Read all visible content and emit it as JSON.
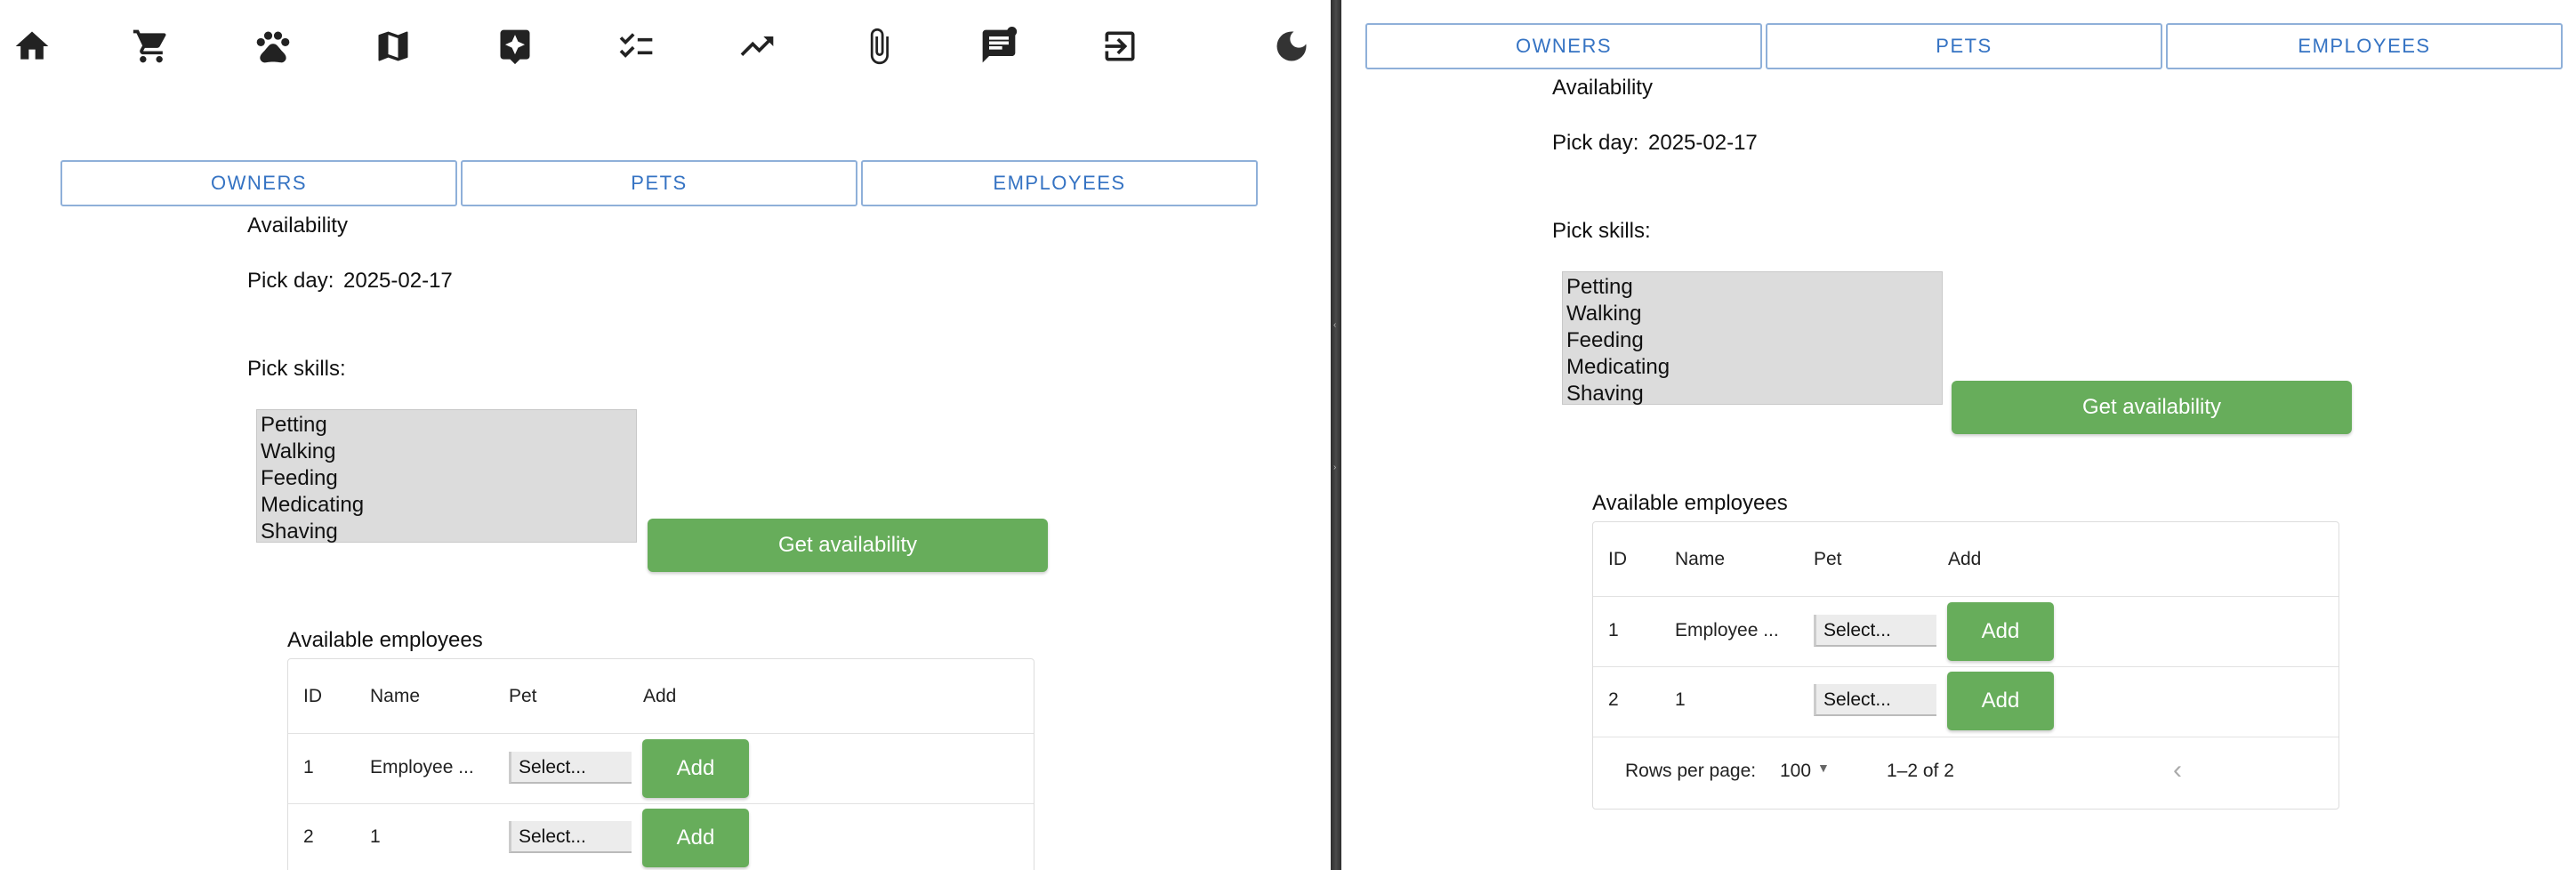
{
  "toolbar": {
    "icons": [
      "home-icon",
      "cart-icon",
      "paw-icon",
      "map-icon",
      "star-chat-icon",
      "checklist-icon",
      "trending-up-icon",
      "attachment-icon",
      "feedback-icon",
      "logout-icon",
      "dark-mode-icon"
    ]
  },
  "tabs": [
    "OWNERS",
    "PETS",
    "EMPLOYEES"
  ],
  "availability": {
    "heading": "Availability",
    "pick_day_label": "Pick day:",
    "pick_day_value": "2025-02-17",
    "pick_skills_label": "Pick skills:",
    "skills": [
      "Petting",
      "Walking",
      "Feeding",
      "Medicating",
      "Shaving"
    ],
    "get_button": "Get availability"
  },
  "employees": {
    "title": "Available employees",
    "columns": [
      "ID",
      "Name",
      "Pet",
      "Add"
    ],
    "rows": [
      {
        "id": "1",
        "name": "Employee ...",
        "pet": "Select...",
        "add": "Add"
      },
      {
        "id": "2",
        "name": "1",
        "pet": "Select...",
        "add": "Add"
      }
    ],
    "footer": {
      "rows_per_page_label": "Rows per page:",
      "rows_per_page_value": "100",
      "range": "1–2 of 2"
    }
  },
  "colors": {
    "accent_green": "#67ad5b",
    "tab_blue": "#3573c3"
  }
}
